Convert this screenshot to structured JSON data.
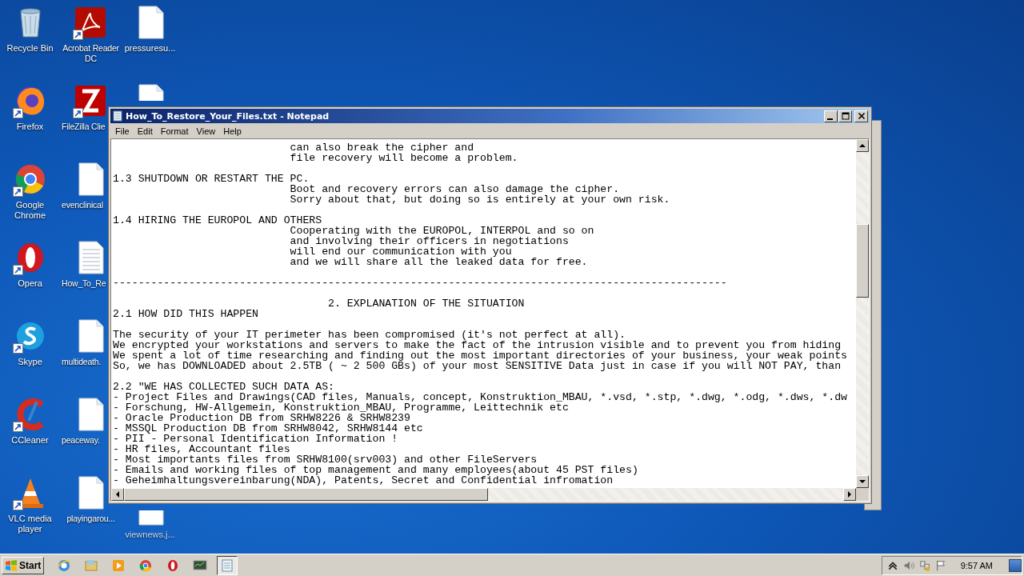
{
  "desktop_columns": [
    {
      "top_icons": [
        {
          "label": "Recycle Bin",
          "kind": "recycle",
          "shortcut": false
        },
        {
          "label": "Firefox",
          "kind": "firefox",
          "shortcut": true
        },
        {
          "label": "Google Chrome",
          "kind": "chrome",
          "shortcut": true
        },
        {
          "label": "Opera",
          "kind": "opera",
          "shortcut": true
        },
        {
          "label": "Skype",
          "kind": "skype",
          "shortcut": true
        },
        {
          "label": "CCleaner",
          "kind": "ccleaner",
          "shortcut": true
        },
        {
          "label": "VLC media player",
          "kind": "vlc",
          "shortcut": true
        }
      ]
    },
    {
      "top_icons": [
        {
          "label": "Acrobat Reader DC",
          "kind": "acrobat",
          "shortcut": true
        },
        {
          "label": "FileZilla Clie",
          "kind": "filezilla",
          "shortcut": true
        },
        {
          "label": "evenclinical",
          "kind": "document",
          "shortcut": false
        },
        {
          "label": "How_To_Re",
          "kind": "textfile",
          "shortcut": false
        },
        {
          "label": "multideath.",
          "kind": "document",
          "shortcut": false
        },
        {
          "label": "peaceway.",
          "kind": "document",
          "shortcut": false
        },
        {
          "label": "playingarou...",
          "kind": "document",
          "shortcut": false
        }
      ]
    },
    {
      "top_icons": [
        {
          "label": "pressuresu...",
          "kind": "document",
          "shortcut": false
        },
        {
          "kind": "document"
        }
      ],
      "bottom_icons": [
        {
          "label": "viewnews.j...",
          "kind": "document",
          "shortcut": false
        }
      ]
    }
  ],
  "notepad": {
    "title": "How_To_Restore_Your_Files.txt - Notepad",
    "menu": [
      "File",
      "Edit",
      "Format",
      "View",
      "Help"
    ],
    "text": "                            can also break the cipher and\n                            file recovery will become a problem.\n\n1.3 SHUTDOWN OR RESTART THE PC.\n                            Boot and recovery errors can also damage the cipher.\n                            Sorry about that, but doing so is entirely at your own risk.\n\n1.4 HIRING THE EUROPOL AND OTHERS\n                            Cooperating with the EUROPOL, INTERPOL and so on\n                            and involving their officers in negotiations\n                            will end our communication with you\n                            and we will share all the leaked data for free.\n\n-------------------------------------------------------------------------------------------------\n\n                                  2. EXPLANATION OF THE SITUATION\n2.1 HOW DID THIS HAPPEN\n\nThe security of your IT perimeter has been compromised (it's not perfect at all).\nWe encrypted your workstations and servers to make the fact of the intrusion visible and to prevent you from hiding\nWe spent a lot of time researching and finding out the most important directories of your business, your weak points\nSo, we has DOWNLOADED about 2.5TB ( ~ 2 500 GBs) of your most SENSITIVE Data just in case if you will NOT PAY, than\n\n2.2 \"WE HAS COLLECTED SUCH DATA AS:\n- Project Files and Drawings(CAD files, Manuals, concept, Konstruktion_MBAU, *.vsd, *.stp, *.dwg, *.odg, *.dws, *.dw\n- Forschung, HW-Allgemein, Konstruktion_MBAU, Programme, Leittechnik etc\n- Oracle Production DB from SRHW8226 & SRHW8239\n- MSSQL Production DB from SRHW8042, SRHW8144 etc\n- PII - Personal Identification Information !\n- HR files, Accountant files\n- Most importants files from SRHW8100(srv003) and other FileServers\n- Emails and working files of top management and many employees(about 45 PST files)\n- Geheimhaltungsvereinbarung(NDA), Patents, Secret and Confidential infromation"
  },
  "taskbar": {
    "start_label": "Start",
    "buttons": [
      {
        "kind": "ie",
        "selected": false
      },
      {
        "kind": "explorer",
        "selected": false
      },
      {
        "kind": "media",
        "selected": false
      },
      {
        "kind": "chrome",
        "selected": false
      },
      {
        "kind": "opera",
        "selected": false
      },
      {
        "kind": "monitor",
        "selected": false
      },
      {
        "kind": "notepad",
        "selected": true
      }
    ],
    "clock": "9:57 AM"
  }
}
